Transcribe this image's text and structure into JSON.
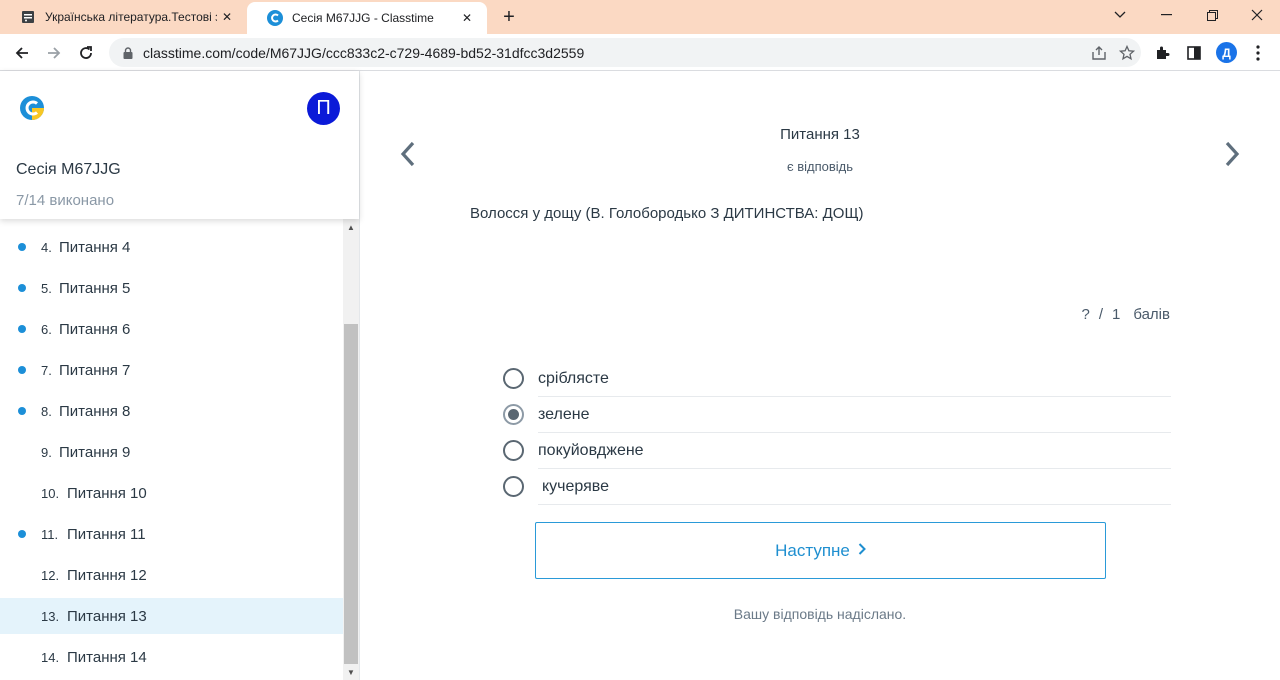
{
  "browser": {
    "tabs": [
      {
        "title": "Українська література.Тестові за",
        "active": false,
        "icon": "document-icon"
      },
      {
        "title": "Сесія M67JJG - Classtime",
        "active": true,
        "icon": "classtime-icon"
      }
    ],
    "url": "classtime.com/code/M67JJG/ccc833c2-c729-4689-bd52-31dfcc3d2559",
    "profile_initial": "Д"
  },
  "sidebar": {
    "avatar_initial": "П",
    "session_title": "Сесія M67JJG",
    "progress": "7/14 виконано",
    "questions": [
      {
        "num": "4.",
        "label": "Питання 4",
        "answered": true,
        "active": false
      },
      {
        "num": "5.",
        "label": "Питання 5",
        "answered": true,
        "active": false
      },
      {
        "num": "6.",
        "label": "Питання 6",
        "answered": true,
        "active": false
      },
      {
        "num": "7.",
        "label": "Питання 7",
        "answered": true,
        "active": false
      },
      {
        "num": "8.",
        "label": "Питання 8",
        "answered": true,
        "active": false
      },
      {
        "num": "9.",
        "label": "Питання 9",
        "answered": false,
        "active": false
      },
      {
        "num": "10.",
        "label": "Питання 10",
        "answered": false,
        "active": false
      },
      {
        "num": "11.",
        "label": "Питання 11",
        "answered": true,
        "active": false
      },
      {
        "num": "12.",
        "label": "Питання 12",
        "answered": false,
        "active": false
      },
      {
        "num": "13.",
        "label": "Питання 13",
        "answered": false,
        "active": true
      },
      {
        "num": "14.",
        "label": "Питання 14",
        "answered": false,
        "active": false
      }
    ]
  },
  "main": {
    "question_title": "Питання 13",
    "question_status": "є відповідь",
    "question_text": "Волосся у дощу (В. Голобородько З ДИТИНСТВА: ДОЩ)",
    "points": {
      "earned": "?",
      "separator": "/",
      "total": "1",
      "unit": "балів"
    },
    "options": [
      {
        "label": "сріблясте",
        "selected": false
      },
      {
        "label": "зелене",
        "selected": true
      },
      {
        "label": "покуйовджене",
        "selected": false
      },
      {
        "label": "кучеряве",
        "selected": false
      }
    ],
    "next_button": "Наступне",
    "submitted_note": "Вашу відповідь надіслано."
  },
  "colors": {
    "accent": "#1f8fd0",
    "answered_dot": "#1c8fd8",
    "active_row": "#e4f3fb",
    "avatar": "#0b1ad8",
    "tabbar": "#fbd9c3"
  }
}
